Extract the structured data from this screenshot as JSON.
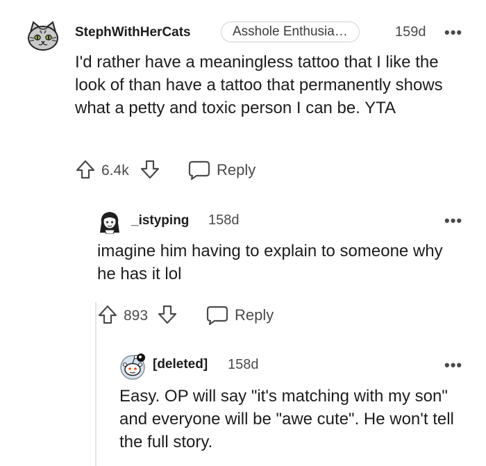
{
  "comments": [
    {
      "username": "StephWithHerCats",
      "flair": "Asshole Enthusia…",
      "age": "159d",
      "more": "•••",
      "body": "I'd rather have a meaningless tattoo that I like the look of than have a tattoo that permanently shows what a petty and toxic person I can be. YTA",
      "votes": "6.4k",
      "reply_label": "Reply",
      "avatar_icon": "cat-avatar-icon"
    },
    {
      "username": "_istyping",
      "age": "158d",
      "more": "•••",
      "body": "imagine him having to explain to someone why he has it lol",
      "votes": "893",
      "reply_label": "Reply",
      "avatar_icon": "girl-avatar-icon"
    },
    {
      "username": "[deleted]",
      "age": "158d",
      "more": "•••",
      "body": "Easy. OP will say \"it's matching with my son\" and everyone will be \"awe cute\". He won't tell the full story.",
      "avatar_icon": "snoo-avatar-icon"
    }
  ],
  "colors": {
    "text": "#1c1c1c",
    "muted": "#4a4a4a",
    "thread_line": "#e3e3e3",
    "flair_border": "#d0d0d0"
  }
}
